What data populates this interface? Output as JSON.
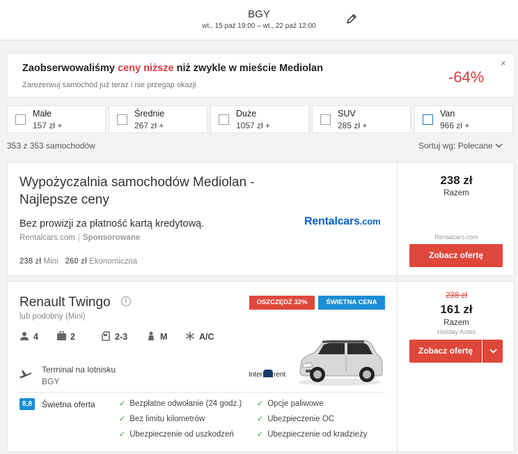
{
  "header": {
    "location": "BGY",
    "dates": "wt., 15 paź 19:00  –  wt., 22 paź 12:00"
  },
  "promo": {
    "title_pre": "Zaobserwowaliśmy ",
    "title_red": "ceny niższe",
    "title_post": " niż zwykle w mieście Mediolan",
    "subtitle": "Zarezerwuj samochód już teraz i nie przegap okazji",
    "discount": "-64%",
    "close": "×"
  },
  "categories": [
    {
      "name": "Małe",
      "price": "157 zł +"
    },
    {
      "name": "Średnie",
      "price": "267 zł +"
    },
    {
      "name": "Duże",
      "price": "1057 zł +"
    },
    {
      "name": "SUV",
      "price": "285 zł +"
    },
    {
      "name": "Van",
      "price": "966 zł +"
    }
  ],
  "results": {
    "count": "353 z 353 samochodów",
    "sort_label": "Sortuj wg: Polecane"
  },
  "ad": {
    "title": "Wypożyczalnia samochodów Mediolan - Najlepsze ceny",
    "description": "Bez prowizji za płatność kartą kredytową.",
    "source": "Rentalcars.com",
    "sponsored": "Sponsorowane",
    "logo_main": "Rentalcars",
    "logo_tld": ".com",
    "price1": "238 zł",
    "type1": "Mini",
    "price2": "260 zł",
    "type2": "Ekonomiczna",
    "total": "238 zł",
    "total_label": "Razem",
    "provider": "Rentalcars.com",
    "cta": "Zobacz ofertę"
  },
  "car": {
    "name": "Renault Twingo",
    "info_icon": "i",
    "similar": "lub podobny (Mini)",
    "badge_save": "OSZCZĘDŹ 32%",
    "badge_great": "ŚWIETNA CENA",
    "specs": {
      "seats": "4",
      "bags": "2",
      "doors": "2-3",
      "transmission": "M",
      "ac": "A/C"
    },
    "terminal": "Terminal na lotnisku",
    "terminal_code": "BGY",
    "supplier_a": "Inter",
    "supplier_b": "rent",
    "score": "8,8",
    "score_label": "Świetna oferta",
    "features": [
      "Bezpłatne odwołanie (24 godz.)",
      "Bez limitu kilometrów",
      "Ubezpieczenie od uszkodzeń",
      "Opcje paliwowe",
      "Ubezpieczenie OC",
      "Ubezpieczenie od kradzieży"
    ],
    "old_price": "238 zł",
    "price": "161 zł",
    "price_label": "Razem",
    "provider": "Holiday Autos",
    "cta": "Zobacz ofertę"
  },
  "colors": {
    "accent_red": "#e0473b",
    "accent_blue": "#1a8ed8",
    "brand_blue": "#0a5fc7"
  }
}
